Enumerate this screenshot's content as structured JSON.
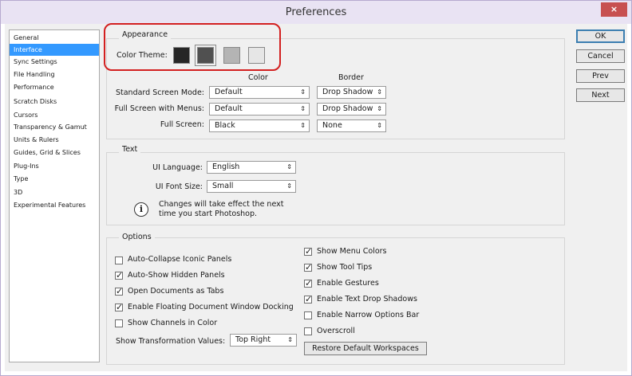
{
  "window": {
    "title": "Preferences",
    "close_glyph": "×"
  },
  "sidebar": {
    "items": [
      {
        "label": "General",
        "selected": false
      },
      {
        "label": "Interface",
        "selected": true
      },
      {
        "label": "Sync Settings",
        "selected": false
      },
      {
        "label": "File Handling",
        "selected": false
      },
      {
        "label": "Performance",
        "selected": false
      },
      {
        "label": "Scratch Disks",
        "selected": false
      },
      {
        "label": "Cursors",
        "selected": false
      },
      {
        "label": "Transparency & Gamut",
        "selected": false
      },
      {
        "label": "Units & Rulers",
        "selected": false
      },
      {
        "label": "Guides, Grid & Slices",
        "selected": false
      },
      {
        "label": "Plug-Ins",
        "selected": false
      },
      {
        "label": "Type",
        "selected": false
      },
      {
        "label": "3D",
        "selected": false
      },
      {
        "label": "Experimental Features",
        "selected": false
      }
    ]
  },
  "buttons": {
    "ok": "OK",
    "cancel": "Cancel",
    "prev": "Prev",
    "next": "Next"
  },
  "appearance": {
    "legend": "Appearance",
    "color_theme_label": "Color Theme:",
    "themes": [
      {
        "name": "theme-darkest",
        "color": "#262626"
      },
      {
        "name": "theme-dark",
        "color": "#505050",
        "selected": true
      },
      {
        "name": "theme-medium",
        "color": "#b4b4b4"
      },
      {
        "name": "theme-light",
        "color": "#e6e6e6"
      }
    ],
    "col_color": "Color",
    "col_border": "Border",
    "rows": [
      {
        "label": "Standard Screen Mode:",
        "color": "Default",
        "border": "Drop Shadow"
      },
      {
        "label": "Full Screen with Menus:",
        "color": "Default",
        "border": "Drop Shadow"
      },
      {
        "label": "Full Screen:",
        "color": "Black",
        "border": "None"
      }
    ]
  },
  "text_group": {
    "legend": "Text",
    "ui_language_label": "UI Language:",
    "ui_language_value": "English",
    "ui_font_size_label": "UI Font Size:",
    "ui_font_size_value": "Small",
    "info_glyph": "i",
    "notice_line1": "Changes will take effect the next",
    "notice_line2": "time you start Photoshop."
  },
  "options": {
    "legend": "Options",
    "left": [
      {
        "label": "Auto-Collapse Iconic Panels",
        "checked": false
      },
      {
        "label": "Auto-Show Hidden Panels",
        "checked": true
      },
      {
        "label": "Open Documents as Tabs",
        "checked": true
      },
      {
        "label": "Enable Floating Document Window Docking",
        "checked": true
      },
      {
        "label": "Show Channels in Color",
        "checked": false
      }
    ],
    "right": [
      {
        "label": "Show Menu Colors",
        "checked": true
      },
      {
        "label": "Show Tool Tips",
        "checked": true
      },
      {
        "label": "Enable Gestures",
        "checked": true
      },
      {
        "label": "Enable Text Drop Shadows",
        "checked": true
      },
      {
        "label": "Enable Narrow Options Bar",
        "checked": false
      },
      {
        "label": "Overscroll",
        "checked": false
      }
    ],
    "transform_label": "Show Transformation Values:",
    "transform_value": "Top Right",
    "restore_button": "Restore Default Workspaces"
  },
  "dropdown_glyph": "⇕"
}
